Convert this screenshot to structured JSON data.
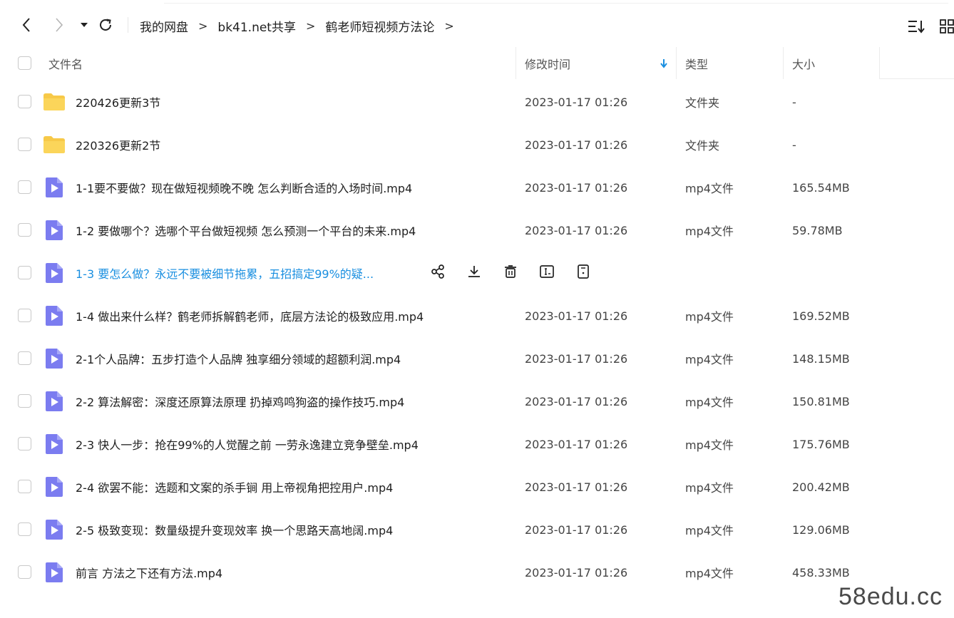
{
  "toolbar": {
    "breadcrumb": [
      "我的网盘",
      "bk41.net共享",
      "鹤老师短视频方法论"
    ],
    "separator": ">"
  },
  "columns": {
    "name": "文件名",
    "modified": "修改时间",
    "type": "类型",
    "size": "大小"
  },
  "files": [
    {
      "name": "220426更新3节",
      "date": "2023-01-17 01:26",
      "type": "文件夹",
      "size": "-",
      "icon": "folder-icon"
    },
    {
      "name": "220326更新2节",
      "date": "2023-01-17 01:26",
      "type": "文件夹",
      "size": "-",
      "icon": "folder-icon"
    },
    {
      "name": "1-1要不要做？现在做短视频晚不晚 怎么判断合适的入场时间.mp4",
      "date": "2023-01-17 01:26",
      "type": "mp4文件",
      "size": "165.54MB",
      "icon": "video-file-icon"
    },
    {
      "name": "1-2 要做哪个？选哪个平台做短视频 怎么预测一个平台的未来.mp4",
      "date": "2023-01-17 01:26",
      "type": "mp4文件",
      "size": "59.78MB",
      "icon": "video-file-icon"
    },
    {
      "name": "1-3 要怎么做？永远不要被细节拖累，五招搞定99%的疑...",
      "date": "",
      "type": "",
      "size": "",
      "icon": "video-file-icon",
      "hovered": true
    },
    {
      "name": "1-4 做出来什么样？鹤老师拆解鹤老师，底层方法论的极致应用.mp4",
      "date": "2023-01-17 01:26",
      "type": "mp4文件",
      "size": "169.52MB",
      "icon": "video-file-icon"
    },
    {
      "name": "2-1个人品牌：五步打造个人品牌 独享细分领域的超额利润.mp4",
      "date": "2023-01-17 01:26",
      "type": "mp4文件",
      "size": "148.15MB",
      "icon": "video-file-icon"
    },
    {
      "name": "2-2 算法解密：深度还原算法原理 扔掉鸡鸣狗盗的操作技巧.mp4",
      "date": "2023-01-17 01:26",
      "type": "mp4文件",
      "size": "150.81MB",
      "icon": "video-file-icon"
    },
    {
      "name": "2-3 快人一步：抢在99%的人觉醒之前 一劳永逸建立竞争壁垒.mp4",
      "date": "2023-01-17 01:26",
      "type": "mp4文件",
      "size": "175.76MB",
      "icon": "video-file-icon"
    },
    {
      "name": "2-4 欲罢不能：选题和文案的杀手锏 用上帝视角把控用户.mp4",
      "date": "2023-01-17 01:26",
      "type": "mp4文件",
      "size": "200.42MB",
      "icon": "video-file-icon"
    },
    {
      "name": "2-5 极致变现：数量级提升变现效率 换一个思路天高地阔.mp4",
      "date": "2023-01-17 01:26",
      "type": "mp4文件",
      "size": "129.06MB",
      "icon": "video-file-icon"
    },
    {
      "name": "前言  方法之下还有方法.mp4",
      "date": "2023-01-17 01:26",
      "type": "mp4文件",
      "size": "458.33MB",
      "icon": "video-file-icon"
    }
  ],
  "hover_actions": [
    "share-icon",
    "download-icon",
    "delete-icon",
    "rename-icon",
    "more-info-icon"
  ],
  "watermark": "58edu.cc",
  "colors": {
    "accent": "#1a8fe0",
    "folder": "#f7c948",
    "video_icon": "#7b7cf0"
  }
}
